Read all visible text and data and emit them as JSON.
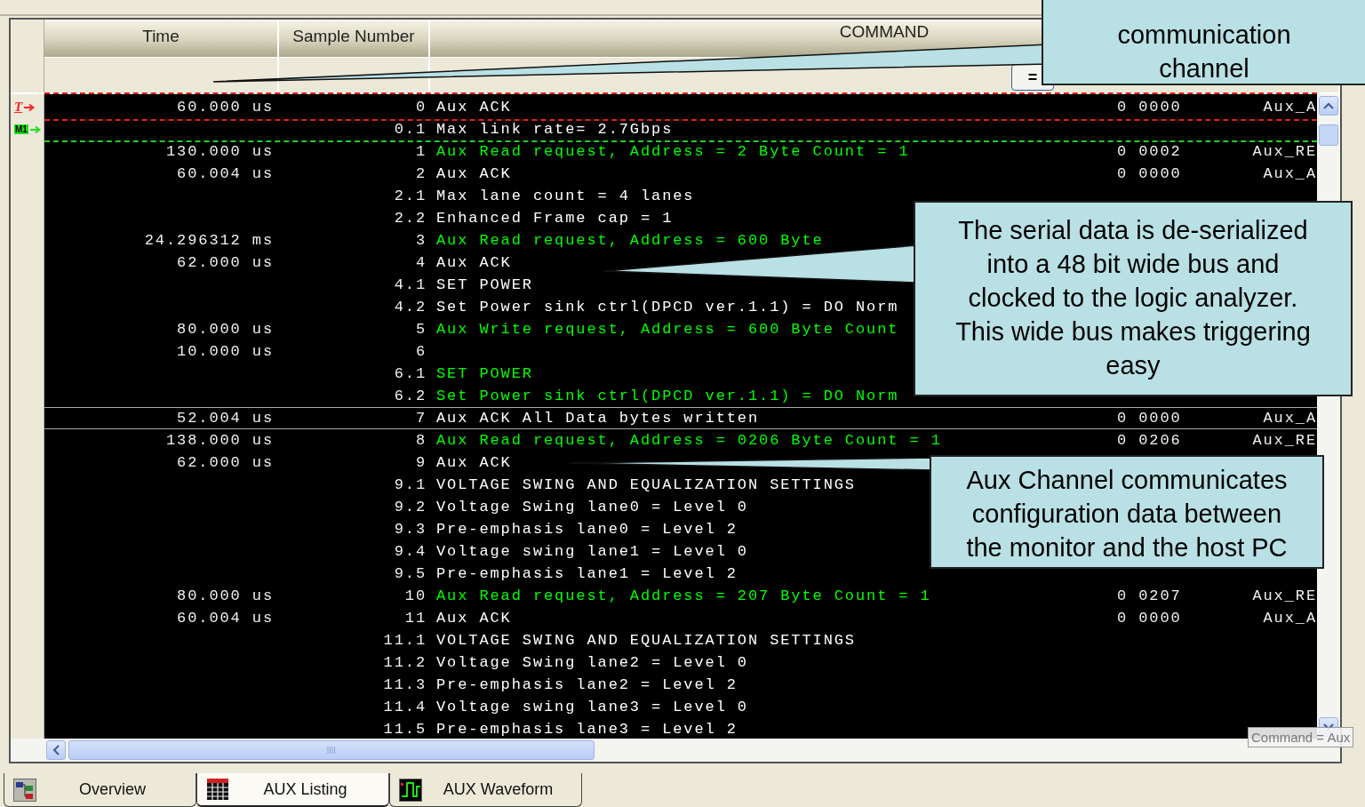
{
  "columns": [
    {
      "label": "Time"
    },
    {
      "label": "Sample Number"
    },
    {
      "label": "COMMAND"
    }
  ],
  "filter": {
    "operator": "="
  },
  "rows": [
    {
      "time": "60.000 us",
      "sample": "0",
      "command": "Aux ACK",
      "color": "#ffffff",
      "data": "0 0000",
      "type": "Aux_A",
      "selected": false,
      "marker": {
        "kind": "trigger",
        "label": "T"
      }
    },
    {
      "sample": "0.1",
      "command": "Max link rate= 2.7Gbps",
      "color": "#ffffff",
      "selected": false,
      "marker": {
        "kind": "marker",
        "label": "M1"
      }
    },
    {
      "time": "130.000 us",
      "sample": "1",
      "command": "Aux Read request, Address = 2 Byte Count = 1",
      "color": "#00ff00",
      "data": "0 0002",
      "type": "Aux_RE",
      "selected": false
    },
    {
      "time": "60.004 us",
      "sample": "2",
      "command": "Aux ACK",
      "color": "#ffffff",
      "data": "0 0000",
      "type": "Aux_A",
      "selected": false
    },
    {
      "sample": "2.1",
      "command": "Max lane count = 4 lanes",
      "color": "#ffffff",
      "selected": false
    },
    {
      "sample": "2.2",
      "command": "Enhanced Frame cap = 1",
      "color": "#ffffff",
      "selected": false
    },
    {
      "time": "24.296312 ms",
      "sample": "3",
      "command": "Aux Read request, Address = 600 Byte",
      "color": "#00ff00",
      "selected": false
    },
    {
      "time": "62.000 us",
      "sample": "4",
      "command": "Aux ACK",
      "color": "#ffffff",
      "selected": false
    },
    {
      "sample": "4.1",
      "command": "SET POWER",
      "color": "#ffffff",
      "selected": false
    },
    {
      "sample": "4.2",
      "command": "Set Power sink ctrl(DPCD ver.1.1) = DO Norm",
      "color": "#ffffff",
      "selected": false
    },
    {
      "time": "80.000 us",
      "sample": "5",
      "command": "Aux Write request, Address = 600 Byte Count",
      "color": "#00ff00",
      "selected": false
    },
    {
      "time": "10.000 us",
      "sample": "6",
      "selected": false
    },
    {
      "sample": "6.1",
      "command": "SET POWER",
      "color": "#00ff00",
      "selected": false
    },
    {
      "sample": "6.2",
      "command": "Set Power sink ctrl(DPCD ver.1.1) = DO Norm",
      "color": "#00ff00",
      "selected": false
    },
    {
      "time": "52.004 us",
      "sample": "7",
      "command": "Aux ACK All Data bytes written",
      "color": "#ffffff",
      "data": "0 0000",
      "type": "Aux_A",
      "selected": true
    },
    {
      "time": "138.000 us",
      "sample": "8",
      "command": "Aux Read request, Address = 0206 Byte Count = 1",
      "color": "#00ff00",
      "data": "0 0206",
      "type": "Aux_RE",
      "selected": false
    },
    {
      "time": "62.000 us",
      "sample": "9",
      "command": "Aux ACK",
      "color": "#ffffff",
      "selected": false
    },
    {
      "sample": "9.1",
      "command": "VOLTAGE SWING AND EQUALIZATION SETTINGS",
      "color": "#ffffff",
      "selected": false
    },
    {
      "sample": "9.2",
      "command": "Voltage Swing lane0 = Level 0",
      "color": "#ffffff",
      "selected": false
    },
    {
      "sample": "9.3",
      "command": "Pre-emphasis lane0 = Level 2",
      "color": "#ffffff",
      "selected": false
    },
    {
      "sample": "9.4",
      "command": "Voltage swing lane1 = Level 0",
      "color": "#ffffff",
      "selected": false
    },
    {
      "sample": "9.5",
      "command": "Pre-emphasis lane1 = Level 2",
      "color": "#ffffff",
      "selected": false
    },
    {
      "time": "80.000 us",
      "sample": "10",
      "command": "Aux Read request, Address = 207 Byte Count = 1",
      "color": "#00ff00",
      "data": "0 0207",
      "type": "Aux_RE",
      "selected": false
    },
    {
      "time": "60.004 us",
      "sample": "11",
      "command": "Aux ACK",
      "color": "#ffffff",
      "data": "0 0000",
      "type": "Aux_A",
      "selected": false
    },
    {
      "sample": "11.1",
      "command": "VOLTAGE SWING AND EQUALIZATION SETTINGS",
      "color": "#ffffff",
      "selected": false
    },
    {
      "sample": "11.2",
      "command": "Voltage Swing lane2 = Level 0",
      "color": "#ffffff",
      "selected": false
    },
    {
      "sample": "11.3",
      "command": "Pre-emphasis lane2 = Level 2",
      "color": "#ffffff",
      "selected": false
    },
    {
      "sample": "11.4",
      "command": "Voltage swing lane3 = Level 0",
      "color": "#ffffff",
      "selected": false
    },
    {
      "sample": "11.5",
      "command": "Pre-emphasis lane3 = Level 2",
      "color": "#ffffff",
      "selected": false
    }
  ],
  "tooltip": "Command = Aux",
  "tabs": [
    {
      "label": "Overview",
      "kind": "overview",
      "selected": false
    },
    {
      "label": "AUX Listing",
      "kind": "listing",
      "selected": true
    },
    {
      "label": "AUX Waveform",
      "kind": "waveform",
      "selected": false
    }
  ],
  "callouts": [
    {
      "kind": "top",
      "lines": [
        "communication",
        "channel"
      ]
    },
    {
      "kind": "middle",
      "lines": [
        "The serial data is de-serialized",
        "into a 48 bit wide bus and",
        "clocked to the logic analyzer.",
        "This wide bus makes triggering",
        "easy"
      ]
    },
    {
      "kind": "bottom",
      "lines": [
        "Aux Channel communicates",
        "configuration data between",
        "the monitor and the host PC"
      ]
    }
  ]
}
